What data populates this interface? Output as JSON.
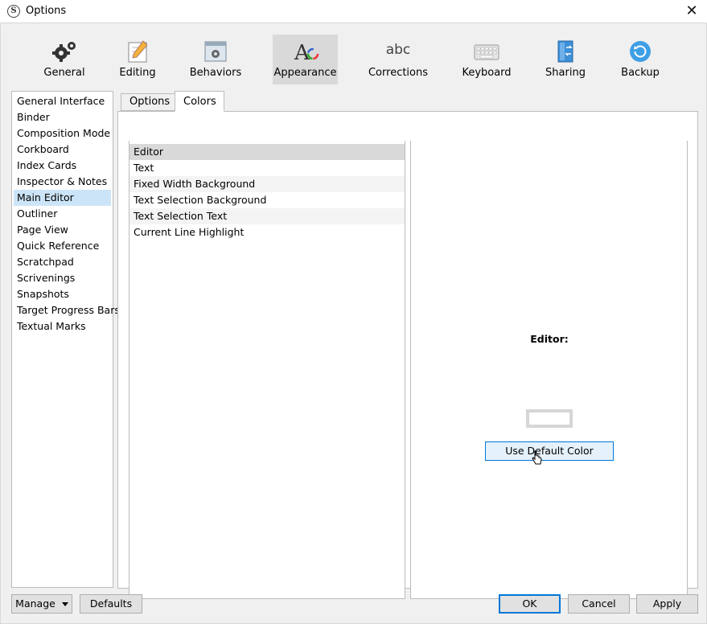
{
  "window": {
    "title": "Options"
  },
  "toolbar": {
    "items": [
      {
        "label": "General",
        "icon": "gears-icon"
      },
      {
        "label": "Editing",
        "icon": "pencil-icon"
      },
      {
        "label": "Behaviors",
        "icon": "window-gear-icon"
      },
      {
        "label": "Appearance",
        "icon": "font-color-icon"
      },
      {
        "label": "Corrections",
        "icon": "abc-icon"
      },
      {
        "label": "Keyboard",
        "icon": "keyboard-icon"
      },
      {
        "label": "Sharing",
        "icon": "sharing-icon"
      },
      {
        "label": "Backup",
        "icon": "backup-icon"
      }
    ],
    "active": "Appearance",
    "corrections_glyph": "abc"
  },
  "sidebar": {
    "items": [
      "General Interface",
      "Binder",
      "Composition Mode",
      "Corkboard",
      "Index Cards",
      "Inspector & Notes",
      "Main Editor",
      "Outliner",
      "Page View",
      "Quick Reference",
      "Scratchpad",
      "Scrivenings",
      "Snapshots",
      "Target Progress Bars",
      "Textual Marks"
    ],
    "selected": "Main Editor"
  },
  "tabs": {
    "items": [
      "Options",
      "Colors"
    ],
    "active": "Colors"
  },
  "color_list": {
    "items": [
      "Editor",
      "Text",
      "Fixed Width Background",
      "Text Selection Background",
      "Text Selection Text",
      "Current Line Highlight"
    ],
    "selected": "Editor"
  },
  "preview": {
    "label": "Editor:",
    "default_button": "Use Default Color",
    "swatch_color": "#ffffff"
  },
  "footer": {
    "manage": "Manage",
    "defaults": "Defaults",
    "ok": "OK",
    "cancel": "Cancel",
    "apply": "Apply"
  },
  "colors": {
    "accent": "#0078d7",
    "selection": "#cce4f7"
  }
}
